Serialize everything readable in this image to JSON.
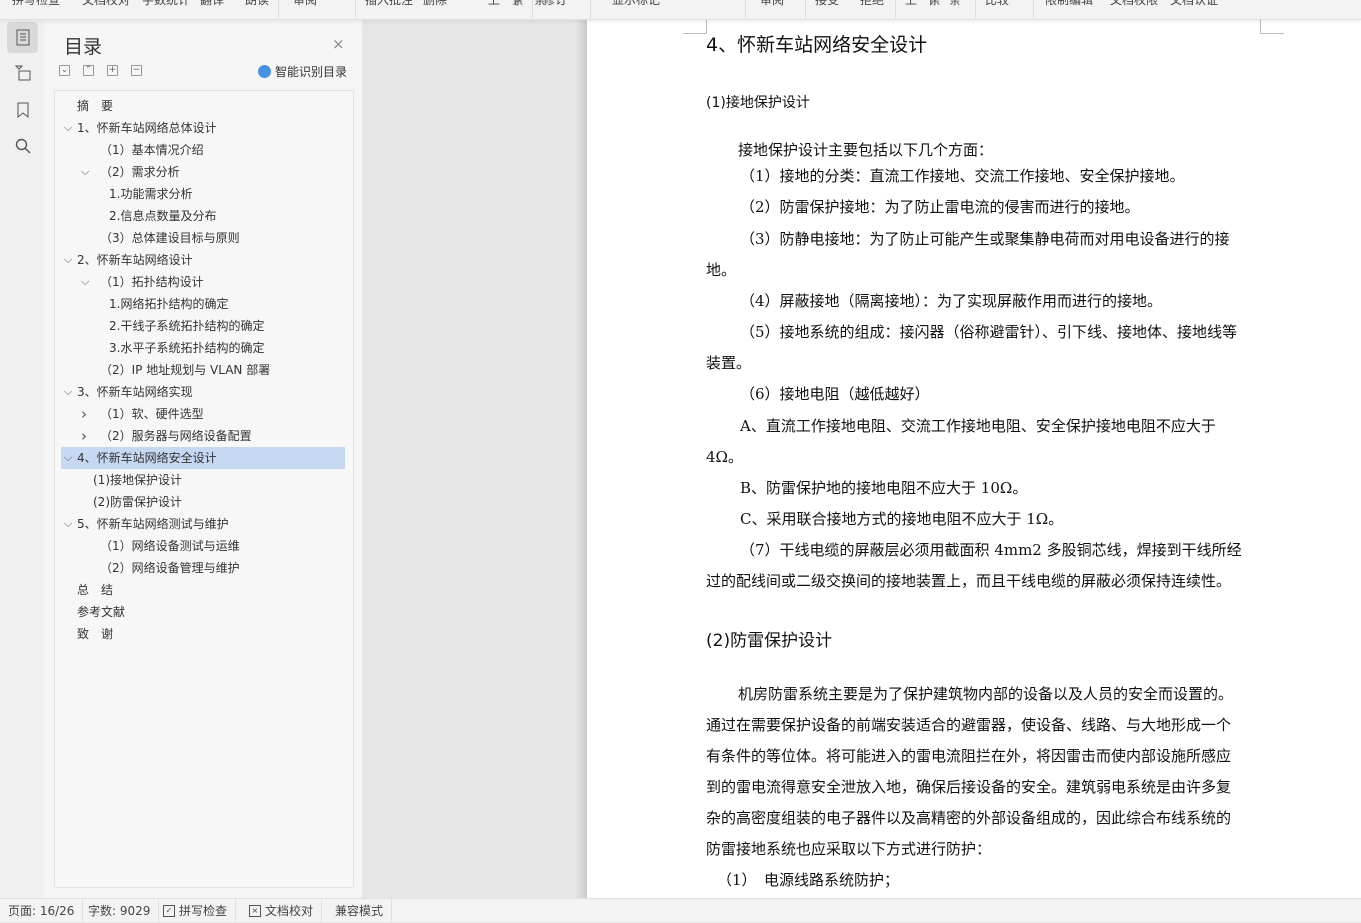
{
  "toolbar": {
    "items": [
      "拼写检查",
      "文档校对",
      "字数统计",
      "翻译",
      "朗读",
      "审阅",
      "插入批注",
      "删除",
      "上一条",
      "下一条",
      "修订",
      "显示标记",
      "审阅",
      "接受",
      "拒绝",
      "上一条",
      "下一条",
      "比较",
      "限制编辑",
      "文档权限",
      "文档认证"
    ]
  },
  "rail": {
    "items": [
      {
        "icon": "toc-icon",
        "selected": true
      },
      {
        "icon": "navigation-tree-icon"
      },
      {
        "icon": "bookmark-icon"
      },
      {
        "icon": "search-icon"
      }
    ]
  },
  "toc": {
    "title": "目录",
    "close": "×",
    "controls": [
      "⌄",
      "⌃",
      "+",
      "−"
    ],
    "smart_label": "智能识别目录",
    "items": [
      {
        "label": "摘　要",
        "level": 1,
        "chevron": ""
      },
      {
        "label": "1、怀新车站网络总体设计",
        "level": 1,
        "chevron": "expanded"
      },
      {
        "label": "（1）基本情况介绍",
        "level": 2,
        "chevron": ""
      },
      {
        "label": "（2）需求分析",
        "level": 2,
        "chevron": "expanded"
      },
      {
        "label": "1.功能需求分析",
        "level": 3,
        "chevron": ""
      },
      {
        "label": "2.信息点数量及分布",
        "level": 3,
        "chevron": ""
      },
      {
        "label": "（3）总体建设目标与原则",
        "level": 2,
        "chevron": ""
      },
      {
        "label": "2、怀新车站网络设计",
        "level": 1,
        "chevron": "expanded"
      },
      {
        "label": "（1）拓扑结构设计",
        "level": 2,
        "chevron": "expanded"
      },
      {
        "label": "1.网络拓扑结构的确定",
        "level": 3,
        "chevron": ""
      },
      {
        "label": "2.干线子系统拓扑结构的确定",
        "level": 3,
        "chevron": ""
      },
      {
        "label": "3.水平子系统拓扑结构的确定",
        "level": 3,
        "chevron": ""
      },
      {
        "label": "（2）IP 地址规划与 VLAN 部署",
        "level": 2,
        "chevron": ""
      },
      {
        "label": "3、怀新车站网络实现",
        "level": 1,
        "chevron": "expanded"
      },
      {
        "label": "（1）软、硬件选型",
        "level": 2,
        "chevron": "collapsed"
      },
      {
        "label": "（2）服务器与网络设备配置",
        "level": 2,
        "chevron": "collapsed"
      },
      {
        "label": "4、怀新车站网络安全设计",
        "level": 1,
        "chevron": "expanded",
        "selected": true
      },
      {
        "label": "(1)接地保护设计",
        "level": "2b",
        "chevron": ""
      },
      {
        "label": "(2)防雷保护设计",
        "level": "2b",
        "chevron": ""
      },
      {
        "label": "5、怀新车站网络测试与维护",
        "level": 1,
        "chevron": "expanded"
      },
      {
        "label": "（1）网络设备测试与运维",
        "level": 2,
        "chevron": ""
      },
      {
        "label": "（2）网络设备管理与维护",
        "level": 2,
        "chevron": ""
      },
      {
        "label": "总　结",
        "level": 1,
        "chevron": ""
      },
      {
        "label": "参考文献",
        "level": 1,
        "chevron": ""
      },
      {
        "label": "致　谢",
        "level": 1,
        "chevron": ""
      }
    ],
    "selection_color": "#c7d8f3"
  },
  "document": {
    "lines": [
      {
        "text": "4、怀新车站网络安全设计",
        "style": "h1"
      },
      {
        "text": "(1)接地保护设计",
        "style": "h3"
      },
      {
        "text": "接地保护设计主要包括以下几个方面：",
        "style": "p"
      },
      {
        "text": "（1）接地的分类：直流工作接地、交流工作接地、安全保护接地。",
        "style": "p"
      },
      {
        "text": "（2）防雷保护接地：为了防止雷电流的侵害而进行的接地。",
        "style": "p"
      },
      {
        "text": "（3）防静电接地：为了防止可能产生或聚集静电荷而对用电设备进行的接",
        "style": "p"
      },
      {
        "text": "地。",
        "style": "p"
      },
      {
        "text": "（4）屏蔽接地（隔离接地）：为了实现屏蔽作用而进行的接地。",
        "style": "p"
      },
      {
        "text": "（5）接地系统的组成：接闪器（俗称避雷针）、引下线、接地体、接地线等",
        "style": "p"
      },
      {
        "text": "装置。",
        "style": "p"
      },
      {
        "text": "（6）接地电阻（越低越好）",
        "style": "p"
      },
      {
        "text": "A、直流工作接地电阻、交流工作接地电阻、安全保护接地电阻不应大于",
        "style": "p"
      },
      {
        "text": "4Ω。",
        "style": "p"
      },
      {
        "text": "B、防雷保护地的接地电阻不应大于 10Ω。",
        "style": "p"
      },
      {
        "text": "C、采用联合接地方式的接地电阻不应大于 1Ω。",
        "style": "p"
      },
      {
        "text": "（7）干线电缆的屏蔽层必须用截面积 4mm2 多股铜芯线，焊接到干线所经",
        "style": "p"
      },
      {
        "text": "过的配线间或二级交换间的接地装置上，而且干线电缆的屏蔽必须保持连续性。",
        "style": "p"
      },
      {
        "text": "(2)防雷保护设计",
        "style": "h2"
      },
      {
        "text": "机房防雷系统主要是为了保护建筑物内部的设备以及人员的安全而设置的。",
        "style": "p"
      },
      {
        "text": "通过在需要保护设备的前端安装适合的避雷器，使设备、线路、与大地形成一个",
        "style": "p"
      },
      {
        "text": "有条件的等位体。将可能进入的雷电流阻拦在外，将因雷击而使内部设施所感应",
        "style": "p"
      },
      {
        "text": "到的雷电流得意安全泄放入地，确保后接设备的安全。建筑弱电系统是由许多复",
        "style": "p"
      },
      {
        "text": "杂的高密度组装的电子器件以及高精密的外部设备组成的，因此综合布线系统的",
        "style": "p"
      },
      {
        "text": "防雷接地系统也应采取以下方式进行防护：",
        "style": "p"
      },
      {
        "text": "（1）　电源线路系统防护；",
        "style": "p"
      }
    ]
  },
  "status": {
    "page": "页面: 16/26",
    "words": "字数: 9029",
    "spell": "拼写检查",
    "proof": "文档校对",
    "compat": "兼容模式"
  }
}
